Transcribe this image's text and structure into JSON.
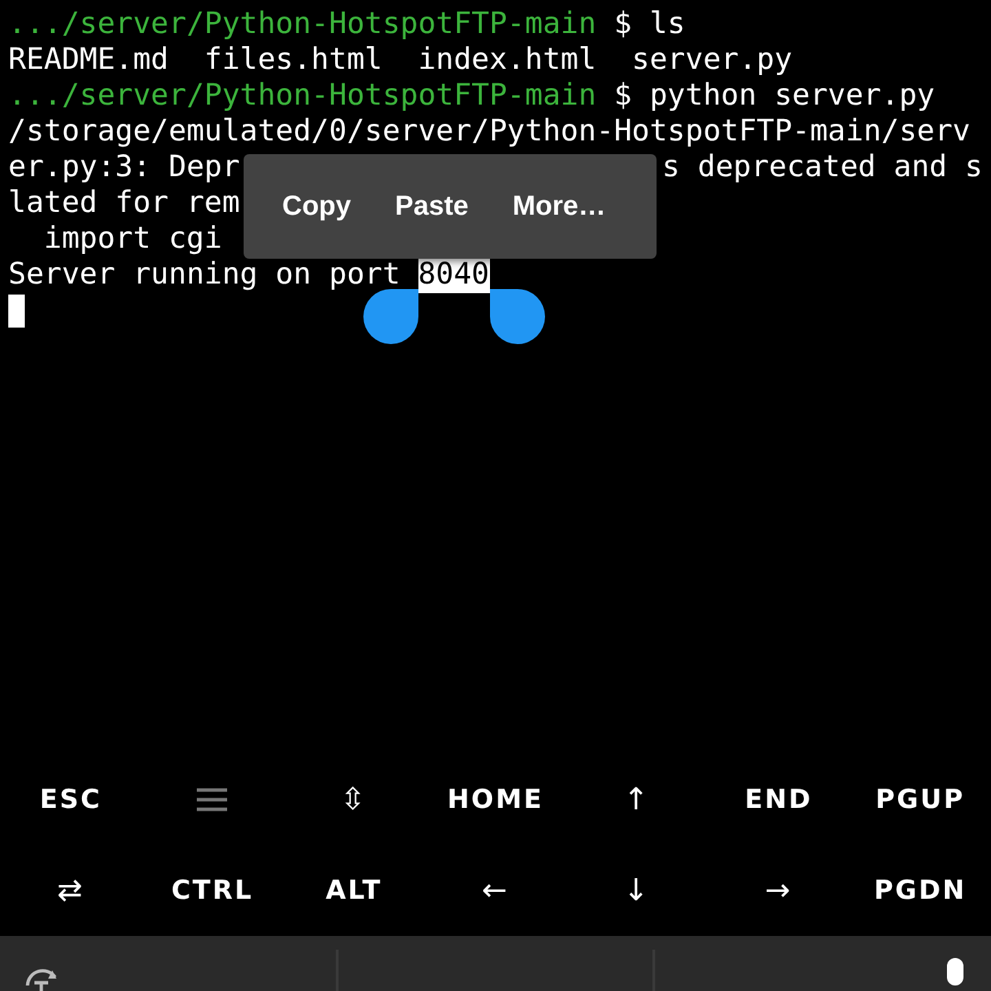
{
  "terminal": {
    "lines": [
      {
        "kind": "plain",
        "segments": [
          {
            "kind": "prompt",
            "text": ".../server/Python-HotspotFTP-main"
          },
          {
            "kind": "output",
            "text": "$ ls"
          }
        ]
      },
      {
        "kind": "plain",
        "segments": [
          {
            "kind": "output",
            "text": "README.md  files.html  index.html  server.py"
          }
        ]
      },
      {
        "kind": "plain",
        "segments": [
          {
            "kind": "prompt",
            "text": ".../server/Python-HotspotFTP-main"
          },
          {
            "kind": "output",
            "text": "$ python server.py"
          }
        ]
      },
      {
        "kind": "plain",
        "segments": [
          {
            "kind": "output",
            "text": "/storage/emulated/0/server/Python-HotspotFTP-main/serv"
          }
        ]
      },
      {
        "kind": "split",
        "segments": [
          {
            "kind": "output",
            "text": "er.py:3: Depr"
          },
          {
            "kind": "output",
            "text": "s deprecated and s"
          }
        ]
      },
      {
        "kind": "plain",
        "segments": [
          {
            "kind": "output",
            "text": "lated for rem"
          }
        ]
      },
      {
        "kind": "indented",
        "segments": [
          {
            "kind": "output",
            "text": "import cgi"
          }
        ]
      },
      {
        "kind": "plain",
        "segments": [
          {
            "kind": "output",
            "text": "Server running on port"
          },
          {
            "kind": "output",
            "text": "8040",
            "selected": true
          }
        ]
      }
    ]
  },
  "context_menu": {
    "items": [
      "Copy",
      "Paste",
      "More…"
    ]
  },
  "extra_keys": [
    [
      {
        "kind": "text",
        "label": "ESC"
      },
      {
        "kind": "drawer"
      },
      {
        "kind": "text",
        "label": "⇳"
      },
      {
        "kind": "text",
        "label": "HOME"
      },
      {
        "kind": "text",
        "label": "↑"
      },
      {
        "kind": "text",
        "label": "END"
      },
      {
        "kind": "text",
        "label": "PGUP"
      }
    ],
    [
      {
        "kind": "text",
        "label": "⇄"
      },
      {
        "kind": "text",
        "label": "CTRL"
      },
      {
        "kind": "text",
        "label": "ALT"
      },
      {
        "kind": "text",
        "label": "←"
      },
      {
        "kind": "text",
        "label": "↓"
      },
      {
        "kind": "text",
        "label": "→"
      },
      {
        "kind": "text",
        "label": "PGDN"
      }
    ]
  ]
}
